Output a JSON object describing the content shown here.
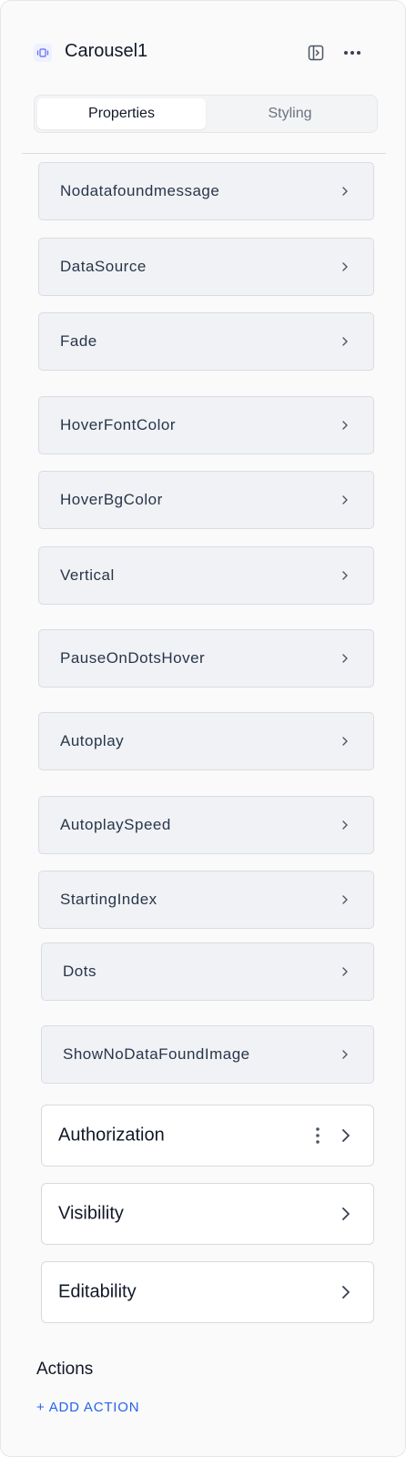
{
  "header": {
    "title": "Carousel1",
    "component_icon": "carousel-icon",
    "panel_toggle_icon": "sidebar-toggle-icon",
    "more_icon": "more-horizontal-icon"
  },
  "tabs": [
    {
      "label": "Properties",
      "active": true
    },
    {
      "label": "Styling",
      "active": false
    }
  ],
  "properties": [
    {
      "label": "Nodatafoundmessage"
    },
    {
      "label": "DataSource"
    },
    {
      "label": "Fade"
    },
    {
      "label": "HoverFontColor"
    },
    {
      "label": "HoverBgColor"
    },
    {
      "label": "Vertical"
    },
    {
      "label": "PauseOnDotsHover"
    },
    {
      "label": "Autoplay"
    },
    {
      "label": "AutoplaySpeed"
    },
    {
      "label": "StartingIndex"
    },
    {
      "label": "Dots"
    },
    {
      "label": "ShowNoDataFoundImage"
    }
  ],
  "sections": [
    {
      "label": "Authorization",
      "has_menu": true
    },
    {
      "label": "Visibility",
      "has_menu": false
    },
    {
      "label": "Editability",
      "has_menu": false
    }
  ],
  "actions": {
    "title": "Actions",
    "add_label": "+ ADD ACTION"
  },
  "colors": {
    "accent": "#2563eb",
    "row_bg": "#f1f2f5",
    "row_border": "#d9dce2"
  }
}
